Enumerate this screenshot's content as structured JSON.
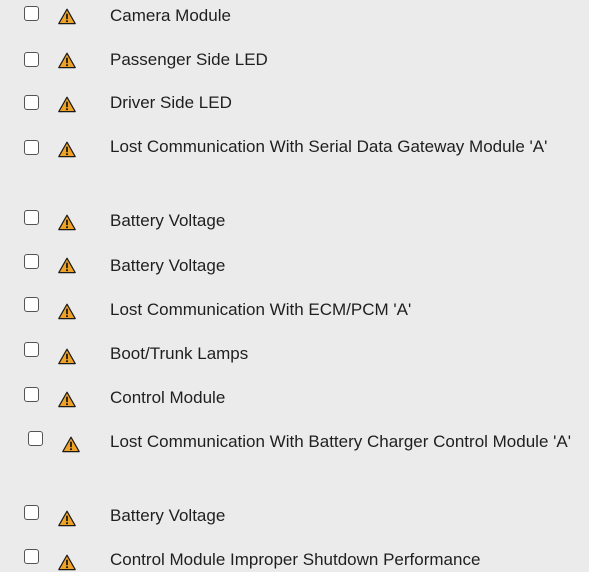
{
  "icons": {
    "checkbox": "checkbox-unchecked",
    "warning": "warning-triangle-icon",
    "warning_fill": "#f0a226",
    "warning_mark": "#1a1a1a"
  },
  "items": [
    {
      "label": "Camera Module",
      "checked": false
    },
    {
      "label": "Passenger Side LED",
      "checked": false
    },
    {
      "label": "Driver Side LED",
      "checked": false
    },
    {
      "label": "Lost Communication With Serial Data Gateway Module 'A'",
      "checked": false
    },
    {
      "label": "Battery Voltage",
      "checked": false
    },
    {
      "label": "Battery Voltage",
      "checked": false
    },
    {
      "label": "Lost Communication With ECM/PCM 'A'",
      "checked": false
    },
    {
      "label": "Boot/Trunk Lamps",
      "checked": false
    },
    {
      "label": "Control Module",
      "checked": false
    },
    {
      "label": "Lost Communication With Battery Charger Control Module 'A'",
      "checked": false
    },
    {
      "label": "Battery Voltage",
      "checked": false
    },
    {
      "label": "Control Module Improper Shutdown Performance",
      "checked": false
    }
  ]
}
